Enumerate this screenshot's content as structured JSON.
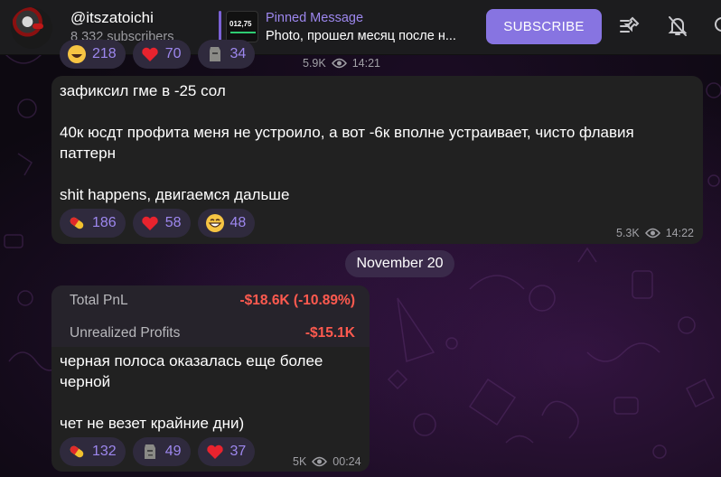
{
  "header": {
    "channel_title": "@itszatoichi",
    "subscribers": "8 332 subscribers",
    "pinned_label": "Pinned Message",
    "pinned_text": "Photo, прошел месяц после н...",
    "pinned_thumb_text": "012,75",
    "subscribe_label": "SUBSCRIBE"
  },
  "messages": [
    {
      "views": "5.9K",
      "time": "14:21",
      "reactions": [
        {
          "emoji": "grinning-face",
          "count": "218"
        },
        {
          "emoji": "red-heart",
          "count": "70"
        },
        {
          "emoji": "moai",
          "count": "34"
        }
      ]
    },
    {
      "text": "зафиксил гме в -25 сол\n\n40к юсдт профита меня не устроило, а вот -6к вполне устраивает, чисто флавия паттерн\n\nshit happens, двигаемся дальше",
      "reactions": [
        {
          "emoji": "pill",
          "count": "186"
        },
        {
          "emoji": "red-heart",
          "count": "58"
        },
        {
          "emoji": "grinning-face",
          "count": "48"
        }
      ],
      "views": "5.3K",
      "time": "14:22"
    },
    {
      "image": {
        "total_pnl_label": "Total PnL",
        "total_pnl_value": "-$18.6K (-10.89%)",
        "unrealized_label": "Unrealized Profits",
        "unrealized_value": "-$15.1K"
      },
      "text": "черная полоса оказалась еще более черной\n\nчет не везет крайние дни)",
      "reactions": [
        {
          "emoji": "pill",
          "count": "132"
        },
        {
          "emoji": "moai",
          "count": "49"
        },
        {
          "emoji": "red-heart",
          "count": "37"
        }
      ],
      "views": "5K",
      "time": "00:24"
    }
  ],
  "date_separator": "November 20",
  "colors": {
    "accent": "#8774e1",
    "bubble": "#212121",
    "reaction_bg": "#2f2a3d",
    "negative": "#ff5a4f"
  }
}
